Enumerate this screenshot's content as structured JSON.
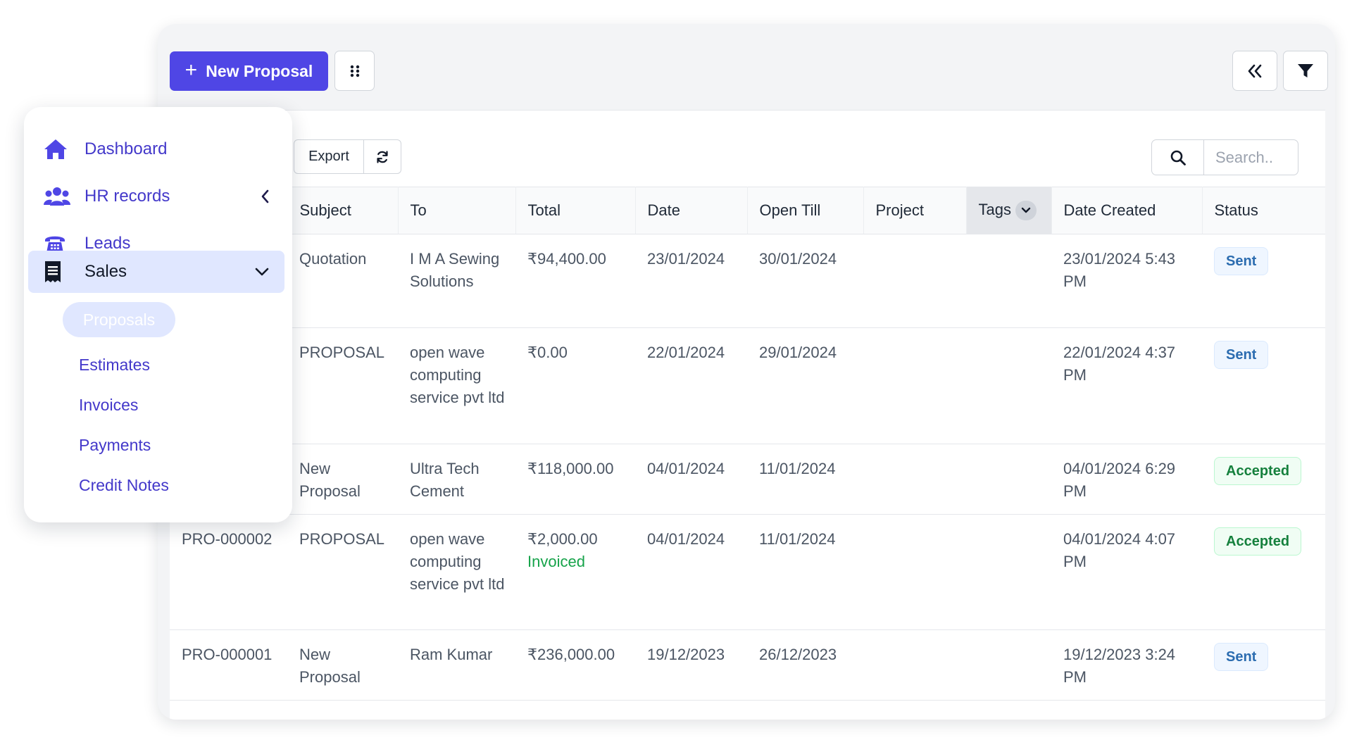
{
  "toolbar": {
    "new_proposal_label": "New Proposal",
    "export_label": "Export",
    "search_placeholder": "Search.."
  },
  "sidebar": {
    "items": [
      {
        "label": "Dashboard",
        "icon": "home-icon"
      },
      {
        "label": "HR records",
        "icon": "users-icon"
      },
      {
        "label": "Leads",
        "icon": "telephone-icon"
      },
      {
        "label": "Sales",
        "icon": "receipt-icon"
      }
    ],
    "sales_submenu": [
      "Proposals",
      "Estimates",
      "Invoices",
      "Payments",
      "Credit Notes"
    ],
    "active_submenu": "Proposals"
  },
  "table": {
    "columns": [
      "Subject",
      "To",
      "Total",
      "Date",
      "Open Till",
      "Project",
      "Tags",
      "Date Created",
      "Status"
    ],
    "rows": [
      {
        "id": "",
        "subject": "Quotation",
        "to": "I M A Sewing Solutions",
        "total": "₹94,400.00",
        "total_note": "",
        "date": "23/01/2024",
        "open_till": "30/01/2024",
        "project": "",
        "tags": "",
        "date_created": "23/01/2024 5:43 PM",
        "status": "Sent"
      },
      {
        "id": "",
        "subject": "PROPOSAL",
        "to": "open wave computing service pvt ltd",
        "total": "₹0.00",
        "total_note": "",
        "date": "22/01/2024",
        "open_till": "29/01/2024",
        "project": "",
        "tags": "",
        "date_created": "22/01/2024 4:37 PM",
        "status": "Sent"
      },
      {
        "id": "",
        "subject": "New Proposal",
        "to": "Ultra Tech Cement",
        "total": "₹118,000.00",
        "total_note": "",
        "date": "04/01/2024",
        "open_till": "11/01/2024",
        "project": "",
        "tags": "",
        "date_created": "04/01/2024 6:29 PM",
        "status": "Accepted"
      },
      {
        "id": "PRO-000002",
        "subject": "PROPOSAL",
        "to": "open wave computing service pvt ltd",
        "total": "₹2,000.00",
        "total_note": "Invoiced",
        "date": "04/01/2024",
        "open_till": "11/01/2024",
        "project": "",
        "tags": "",
        "date_created": "04/01/2024 4:07 PM",
        "status": "Accepted"
      },
      {
        "id": "PRO-000001",
        "subject": "New Proposal",
        "to": "Ram Kumar",
        "total": "₹236,000.00",
        "total_note": "",
        "date": "19/12/2023",
        "open_till": "26/12/2023",
        "project": "",
        "tags": "",
        "date_created": "19/12/2023 3:24 PM",
        "status": "Sent"
      }
    ]
  },
  "colors": {
    "primary": "#4f46e5",
    "sent": "#2b6cb0",
    "accepted": "#15803d",
    "invoiced": "#16a34a"
  }
}
